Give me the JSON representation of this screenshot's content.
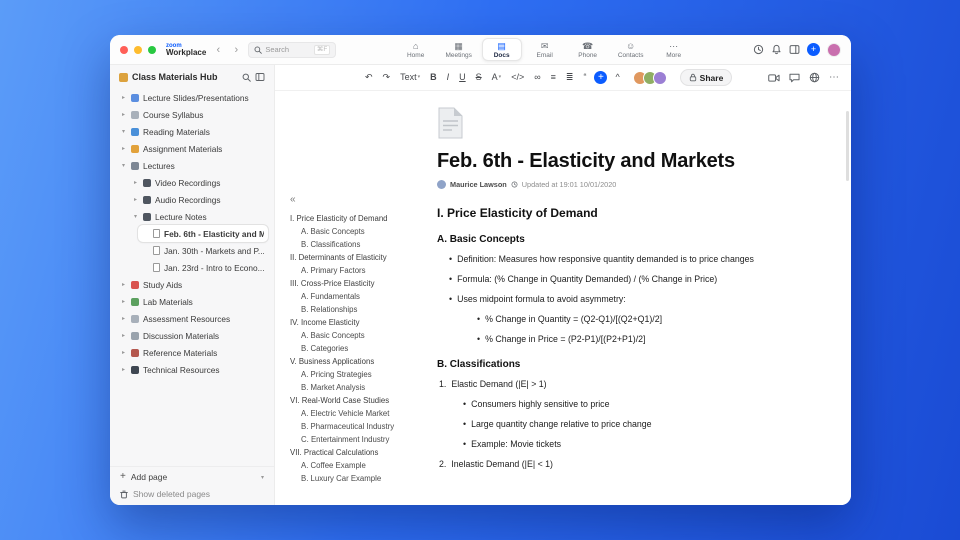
{
  "colors": {
    "accent": "#0b5cff",
    "toolbar_avatars": [
      "#e0985f",
      "#8fae63",
      "#9b7fd4"
    ],
    "profile_avatar": "#c96fae"
  },
  "brand": {
    "logo": "zoom",
    "name": "Workplace"
  },
  "icons": {
    "back": "‹",
    "forward": "›",
    "toc_collapse": "«",
    "more": "⋯",
    "add": "+",
    "footer_caret": "▾"
  },
  "titlebar": {
    "search": {
      "placeholder": "Search",
      "shortcut": "⌘F"
    },
    "tabs": [
      {
        "label": "Home",
        "icon": "home-icon",
        "glyph": "⌂",
        "active": false
      },
      {
        "label": "Meetings",
        "icon": "meetings-icon",
        "glyph": "▦",
        "active": false
      },
      {
        "label": "Docs",
        "icon": "docs-icon",
        "glyph": "▤",
        "active": true
      },
      {
        "label": "Email",
        "icon": "email-icon",
        "glyph": "✉",
        "active": false
      },
      {
        "label": "Phone",
        "icon": "phone-icon",
        "glyph": "☎",
        "active": false
      },
      {
        "label": "Contacts",
        "icon": "contacts-icon",
        "glyph": "☺",
        "active": false
      },
      {
        "label": "More",
        "icon": "more-icon",
        "glyph": "⋯",
        "active": false
      }
    ]
  },
  "sidebar": {
    "title": "Class Materials Hub",
    "items": [
      {
        "label": "Lecture Slides/Presentations",
        "level": 0,
        "chevron": "right",
        "icon_name": "presentations-icon",
        "icon_color": "#5b8ee0"
      },
      {
        "label": "Course Syllabus",
        "level": 0,
        "chevron": "right",
        "icon_name": "syllabus-icon",
        "icon_color": "#a8b0ba"
      },
      {
        "label": "Reading Materials",
        "level": 0,
        "chevron": "down",
        "icon_name": "reading-materials-icon",
        "icon_color": "#4a90d9"
      },
      {
        "label": "Assignment Materials",
        "level": 0,
        "chevron": "right",
        "icon_name": "assignment-materials-icon",
        "icon_color": "#e2a23b"
      },
      {
        "label": "Lectures",
        "level": 0,
        "chevron": "down",
        "icon_name": "lectures-icon",
        "icon_color": "#7d8794"
      },
      {
        "label": "Video Recordings",
        "level": 1,
        "chevron": "right",
        "icon_name": "video-recordings-icon",
        "icon_color": "#4f5660"
      },
      {
        "label": "Audio Recordings",
        "level": 1,
        "chevron": "right",
        "icon_name": "audio-recordings-icon",
        "icon_color": "#4f5660"
      },
      {
        "label": "Lecture Notes",
        "level": 1,
        "chevron": "down",
        "icon_name": "lecture-notes-icon",
        "icon_color": "#4f5660"
      },
      {
        "label": "Feb. 6th - Elasticity and M...",
        "level": 2,
        "icon": "page",
        "icon_name": "page-icon",
        "selected": true
      },
      {
        "label": "Jan. 30th - Markets and P...",
        "level": 2,
        "icon": "page",
        "icon_name": "page-icon",
        "selected": false
      },
      {
        "label": "Jan. 23rd - Intro to Econo...",
        "level": 2,
        "icon": "page",
        "icon_name": "page-icon",
        "selected": false
      },
      {
        "label": "Study Aids",
        "level": 0,
        "chevron": "right",
        "icon_name": "study-aids-icon",
        "icon_color": "#d9534f"
      },
      {
        "label": "Lab Materials",
        "level": 0,
        "chevron": "right",
        "icon_name": "lab-materials-icon",
        "icon_color": "#5ca05f"
      },
      {
        "label": "Assessment Resources",
        "level": 0,
        "chevron": "right",
        "icon_name": "assessment-resources-icon",
        "icon_color": "#a8b0ba"
      },
      {
        "label": "Discussion Materials",
        "level": 0,
        "chevron": "right",
        "icon_name": "discussion-materials-icon",
        "icon_color": "#9aa3ad"
      },
      {
        "label": "Reference Materials",
        "level": 0,
        "chevron": "right",
        "icon_name": "reference-materials-icon",
        "icon_color": "#b4574e"
      },
      {
        "label": "Technical Resources",
        "level": 0,
        "chevron": "right",
        "icon_name": "technical-resources-icon",
        "icon_color": "#3f4752"
      }
    ],
    "footer": {
      "add_page": "Add page",
      "show_deleted": "Show deleted pages"
    }
  },
  "toolbar": {
    "items": [
      {
        "name": "undo",
        "glyph": "↶"
      },
      {
        "name": "redo",
        "glyph": "↷"
      },
      {
        "name": "text-style",
        "glyph": "Text",
        "caret": true
      },
      {
        "name": "bold",
        "glyph": "B"
      },
      {
        "name": "italic",
        "glyph": "I"
      },
      {
        "name": "underline",
        "glyph": "U"
      },
      {
        "name": "strikethrough",
        "glyph": "S"
      },
      {
        "name": "text-color",
        "glyph": "A",
        "caret": true
      },
      {
        "name": "code",
        "glyph": "</>"
      },
      {
        "name": "link",
        "glyph": "∞"
      },
      {
        "name": "bulleted-list",
        "glyph": "≡"
      },
      {
        "name": "numbered-list",
        "glyph": "≣"
      },
      {
        "name": "quote",
        "glyph": "“"
      },
      {
        "name": "insert",
        "glyph": "+"
      },
      {
        "name": "collapse-toolbar",
        "glyph": "^"
      }
    ],
    "share_label": "Share"
  },
  "toc": {
    "items": [
      {
        "text": "I. Price Elasticity of Demand",
        "level": 0
      },
      {
        "text": "A. Basic Concepts",
        "level": 1
      },
      {
        "text": "B. Classifications",
        "level": 1
      },
      {
        "text": "II. Determinants of Elasticity",
        "level": 0
      },
      {
        "text": "A. Primary Factors",
        "level": 1
      },
      {
        "text": "III. Cross-Price Elasticity",
        "level": 0
      },
      {
        "text": "A. Fundamentals",
        "level": 1
      },
      {
        "text": "B. Relationships",
        "level": 1
      },
      {
        "text": "IV. Income Elasticity",
        "level": 0
      },
      {
        "text": "A. Basic Concepts",
        "level": 1
      },
      {
        "text": "B. Categories",
        "level": 1
      },
      {
        "text": "V. Business Applications",
        "level": 0
      },
      {
        "text": "A. Pricing Strategies",
        "level": 1
      },
      {
        "text": "B. Market Analysis",
        "level": 1
      },
      {
        "text": "VI. Real-World Case Studies",
        "level": 0
      },
      {
        "text": "A. Electric Vehicle Market",
        "level": 1
      },
      {
        "text": "B. Pharmaceutical Industry",
        "level": 1
      },
      {
        "text": "C. Entertainment Industry",
        "level": 1
      },
      {
        "text": "VII. Practical Calculations",
        "level": 0
      },
      {
        "text": "A. Coffee Example",
        "level": 1
      },
      {
        "text": "B. Luxury Car Example",
        "level": 1
      }
    ]
  },
  "doc": {
    "title": "Feb. 6th - Elasticity and Markets",
    "author": "Maurice Lawson",
    "updated": "Updated at 19:01 10/01/2020",
    "blocks": [
      {
        "type": "h2",
        "text": "I. Price Elasticity of Demand"
      },
      {
        "type": "h3",
        "text": "A. Basic Concepts"
      },
      {
        "type": "bullet",
        "level": 1,
        "text": "Definition: Measures how responsive quantity demanded is to price changes"
      },
      {
        "type": "bullet",
        "level": 1,
        "text": "Formula: (% Change in Quantity Demanded) / (% Change in Price)"
      },
      {
        "type": "bullet",
        "level": 1,
        "text": "Uses midpoint formula to avoid asymmetry:"
      },
      {
        "type": "bullet",
        "level": 3,
        "text": "% Change in Quantity = (Q2-Q1)/[(Q2+Q1)/2]"
      },
      {
        "type": "bullet",
        "level": 3,
        "text": "% Change in Price = (P2-P1)/[(P2+P1)/2]"
      },
      {
        "type": "h3",
        "text": "B. Classifications"
      },
      {
        "type": "numbered",
        "number": "1.",
        "text": "Elastic Demand (|E| > 1)"
      },
      {
        "type": "bullet",
        "level": 2,
        "text": "Consumers highly sensitive to price"
      },
      {
        "type": "bullet",
        "level": 2,
        "text": "Large quantity change relative to price change"
      },
      {
        "type": "bullet",
        "level": 2,
        "text": "Example: Movie tickets"
      },
      {
        "type": "numbered",
        "number": "2.",
        "text": "Inelastic Demand (|E| < 1)"
      }
    ]
  }
}
